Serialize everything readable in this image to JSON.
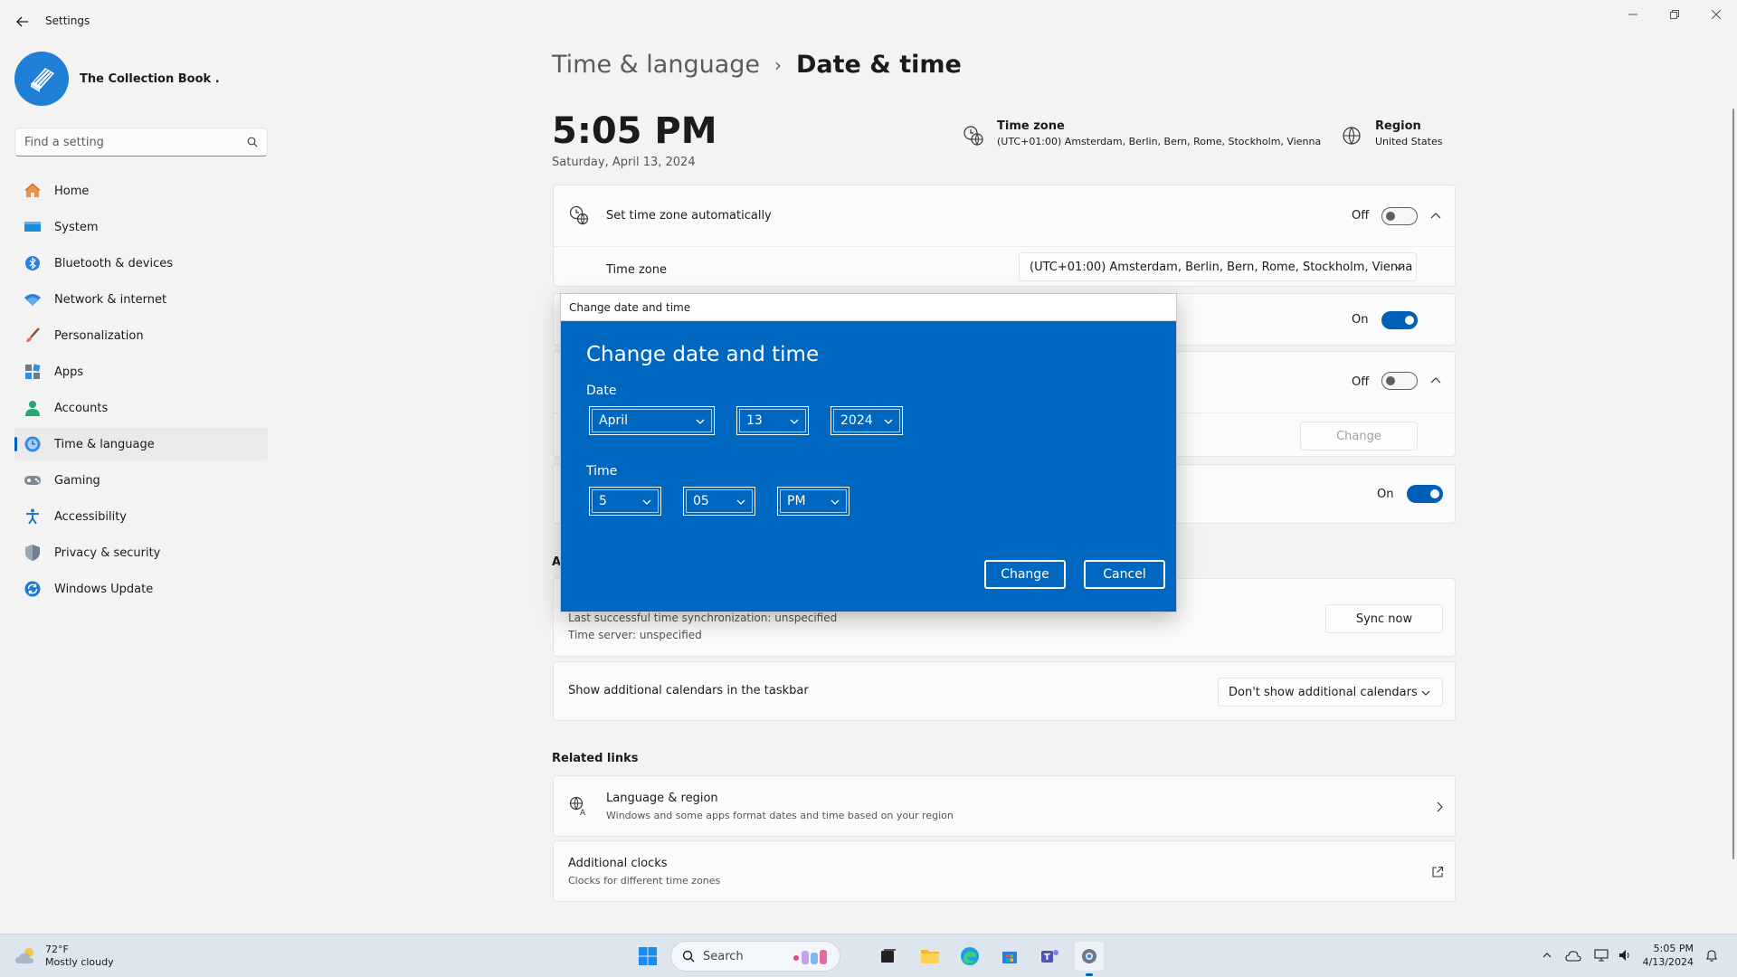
{
  "window": {
    "title": "Settings"
  },
  "profile": {
    "name": "The Collection Book ."
  },
  "search": {
    "placeholder": "Find a setting"
  },
  "sidebar": {
    "items": [
      {
        "label": "Home",
        "icon": "home-icon"
      },
      {
        "label": "System",
        "icon": "monitor-icon"
      },
      {
        "label": "Bluetooth & devices",
        "icon": "bluetooth-icon"
      },
      {
        "label": "Network & internet",
        "icon": "wifi-icon"
      },
      {
        "label": "Personalization",
        "icon": "brush-icon"
      },
      {
        "label": "Apps",
        "icon": "apps-icon"
      },
      {
        "label": "Accounts",
        "icon": "person-icon"
      },
      {
        "label": "Time & language",
        "icon": "clock-globe-icon",
        "active": true
      },
      {
        "label": "Gaming",
        "icon": "gamepad-icon"
      },
      {
        "label": "Accessibility",
        "icon": "accessibility-icon"
      },
      {
        "label": "Privacy & security",
        "icon": "shield-icon"
      },
      {
        "label": "Windows Update",
        "icon": "update-icon"
      }
    ]
  },
  "breadcrumb": {
    "parent": "Time & language",
    "separator": "›",
    "current": "Date & time"
  },
  "clock": {
    "time": "5:05 PM",
    "date": "Saturday, April 13, 2024"
  },
  "timezone_info": {
    "title": "Time zone",
    "value": "(UTC+01:00) Amsterdam, Berlin, Bern, Rome, Stockholm, Vienna"
  },
  "region_info": {
    "title": "Region",
    "value": "United States"
  },
  "settings": {
    "auto_timezone": {
      "label": "Set time zone automatically",
      "state": "Off"
    },
    "timezone": {
      "label": "Time zone",
      "value": "(UTC+01:00) Amsterdam, Berlin, Bern, Rome, Stockholm, Vienna"
    },
    "row2": {
      "state": "On"
    },
    "row3": {
      "state": "Off"
    },
    "change_button": "Change",
    "row4": {
      "state": "On"
    },
    "sync": {
      "last_sync": "Last successful time synchronization: unspecified",
      "server": "Time server: unspecified",
      "button": "Sync now"
    },
    "calendars": {
      "label": "Show additional calendars in the taskbar",
      "value": "Don't show additional calendars"
    },
    "partial_heading": "A"
  },
  "related": {
    "heading": "Related links",
    "language_region": {
      "title": "Language & region",
      "sub": "Windows and some apps format dates and time based on your region"
    },
    "additional_clocks": {
      "title": "Additional clocks",
      "sub": "Clocks for different time zones"
    }
  },
  "dialog": {
    "window_title": "Change date and time",
    "heading": "Change date and time",
    "date_label": "Date",
    "month": "April",
    "day": "13",
    "year": "2024",
    "time_label": "Time",
    "hour": "5",
    "minute": "05",
    "ampm": "PM",
    "change_button": "Change",
    "cancel_button": "Cancel",
    "colors": {
      "background": "#0067c0"
    }
  },
  "taskbar": {
    "weather": {
      "temp": "72°F",
      "condition": "Mostly cloudy"
    },
    "search_label": "Search",
    "clock_time": "5:05 PM",
    "clock_date": "4/13/2024"
  },
  "colors": {
    "accent": "#005fb8",
    "dialog_blue": "#0067c0"
  }
}
